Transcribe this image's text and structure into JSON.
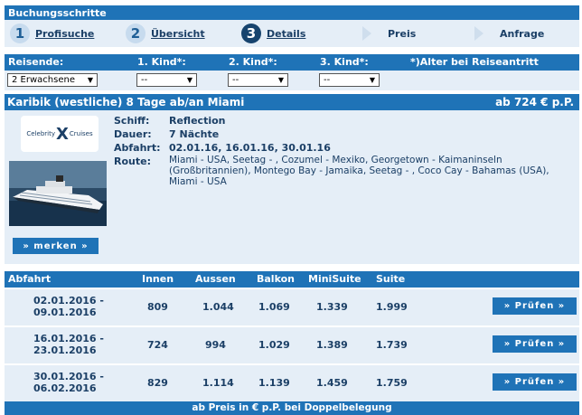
{
  "steps": {
    "title": "Buchungsschritte",
    "items": [
      {
        "num": "1",
        "label": "Profisuche"
      },
      {
        "num": "2",
        "label": "Übersicht"
      },
      {
        "num": "3",
        "label": "Details"
      },
      {
        "label": "Preis"
      },
      {
        "label": "Anfrage"
      }
    ]
  },
  "filters": {
    "reisende_label": "Reisende:",
    "kind1_label": "1. Kind*:",
    "kind2_label": "2. Kind*:",
    "kind3_label": "3. Kind*:",
    "note": "*)Alter bei Reiseantritt",
    "reisende_value": "2 Erwachsene",
    "kind1_value": "--",
    "kind2_value": "--",
    "kind3_value": "--"
  },
  "cruise": {
    "title": "Karibik (westliche) 8 Tage ab/an Miami",
    "price": "ab 724 € p.P.",
    "logo_left": "Celebrity",
    "logo_x": "X",
    "logo_right": "Cruises",
    "merken_label": "» merken »",
    "labels": {
      "ship": "Schiff:",
      "duration": "Dauer:",
      "departure": "Abfahrt:",
      "route": "Route:"
    },
    "ship": "Reflection",
    "duration": "7 Nächte",
    "departure": "02.01.16, 16.01.16, 30.01.16",
    "route": "Miami - USA, Seetag - , Cozumel - Mexiko, Georgetown - Kaimaninseln (Großbritannien), Montego Bay - Jamaika, Seetag - , Coco Cay - Bahamas (USA), Miami - USA"
  },
  "table": {
    "headers": {
      "abfahrt": "Abfahrt",
      "innen": "Innen",
      "aussen": "Aussen",
      "balkon": "Balkon",
      "minisuite": "MiniSuite",
      "suite": "Suite"
    },
    "rows": [
      {
        "from": "02.01.2016 -",
        "to": "09.01.2016",
        "innen": "809",
        "aussen": "1.044",
        "balkon": "1.069",
        "minisuite": "1.339",
        "suite": "1.999",
        "button": "» Prüfen »"
      },
      {
        "from": "16.01.2016 -",
        "to": "23.01.2016",
        "innen": "724",
        "aussen": "994",
        "balkon": "1.029",
        "minisuite": "1.389",
        "suite": "1.739",
        "button": "» Prüfen »"
      },
      {
        "from": "30.01.2016 -",
        "to": "06.02.2016",
        "innen": "829",
        "aussen": "1.114",
        "balkon": "1.139",
        "minisuite": "1.459",
        "suite": "1.759",
        "button": "» Prüfen »"
      }
    ],
    "footer": "ab Preis in € p.P. bei Doppelbelegung"
  },
  "colors": {
    "accent": "#1f73b7",
    "panel": "#e5eef7",
    "text": "#1b3f66"
  }
}
